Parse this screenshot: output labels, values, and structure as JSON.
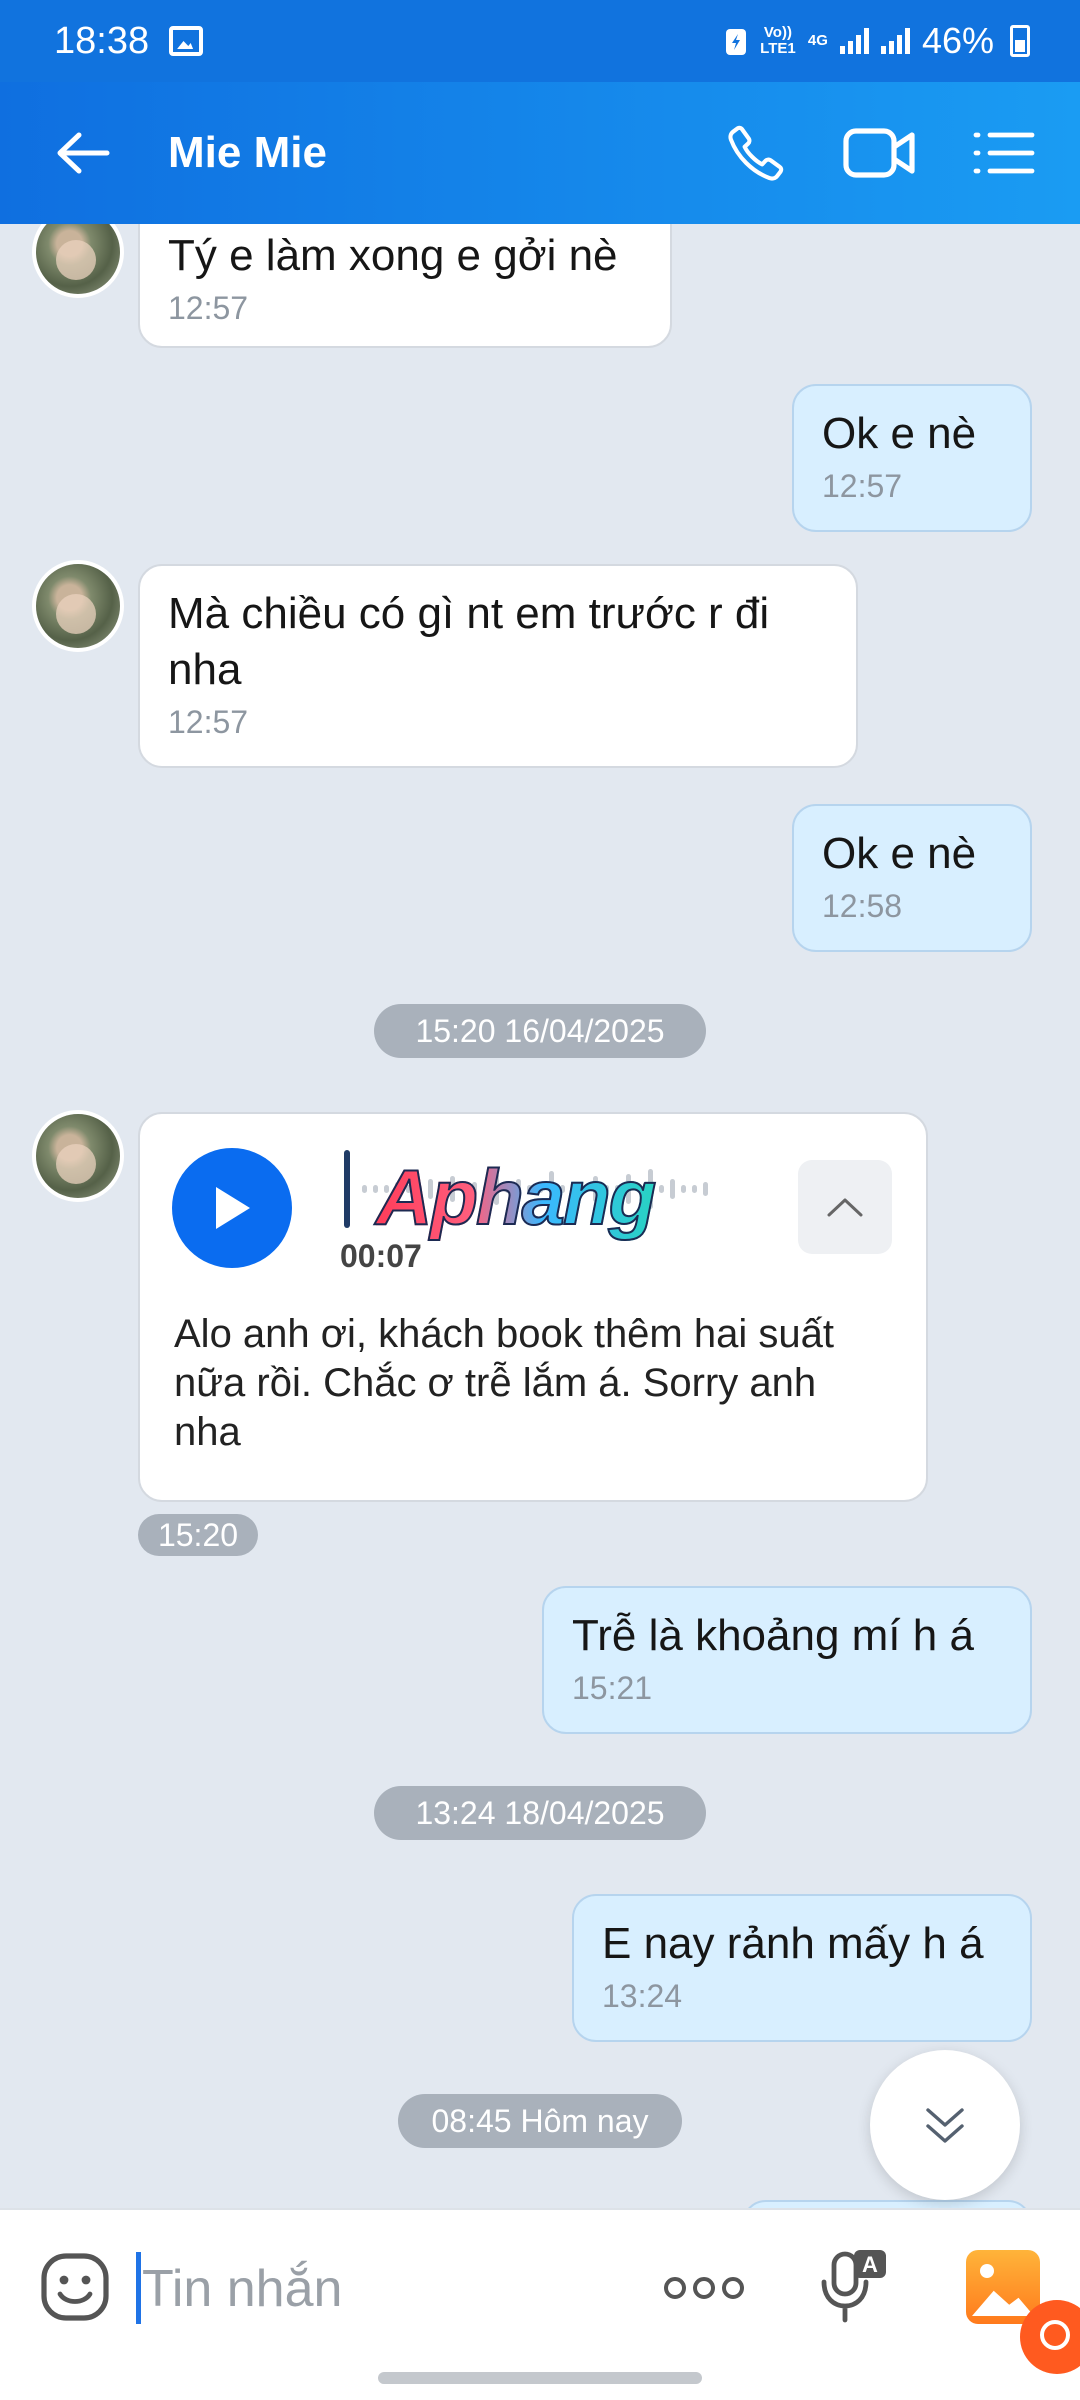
{
  "status_bar": {
    "time": "18:38",
    "volte": "Vo)) LTE1",
    "network": "4G",
    "battery": "46%"
  },
  "header": {
    "title": "Mie Mie"
  },
  "messages": [
    {
      "text": "Tý e làm xong e gởi nè",
      "time": "12:57"
    },
    {
      "text": "Ok e nè",
      "time": "12:57"
    },
    {
      "text": "Mà chiều có gì nt em trước r đi nha",
      "time": "12:57"
    },
    {
      "text": "Ok e nè",
      "time": "12:58"
    },
    {
      "text": "Trễ là khoảng mí h á",
      "time": "15:21"
    },
    {
      "text": "E nay rảnh mấy h á",
      "time": "13:24"
    }
  ],
  "date_separators": [
    "15:20 16/04/2025",
    "13:24 18/04/2025",
    "08:45 Hôm nay"
  ],
  "voice_message": {
    "duration": "00:07",
    "transcript": "Alo anh ơi, khách book thêm hai suất nữa rồi. Chắc ơ trễ lắm á. Sorry anh nha",
    "time": "15:20",
    "watermark": "Aphang"
  },
  "input": {
    "placeholder": "Tin nhắn"
  },
  "colors": {
    "header_start": "#0f6fe0",
    "header_end": "#1a9cf3",
    "chat_background": "#e2e8f0",
    "outgoing_bubble": "#d8efff",
    "incoming_bubble": "#ffffff",
    "play_button": "#0a6cf0"
  }
}
